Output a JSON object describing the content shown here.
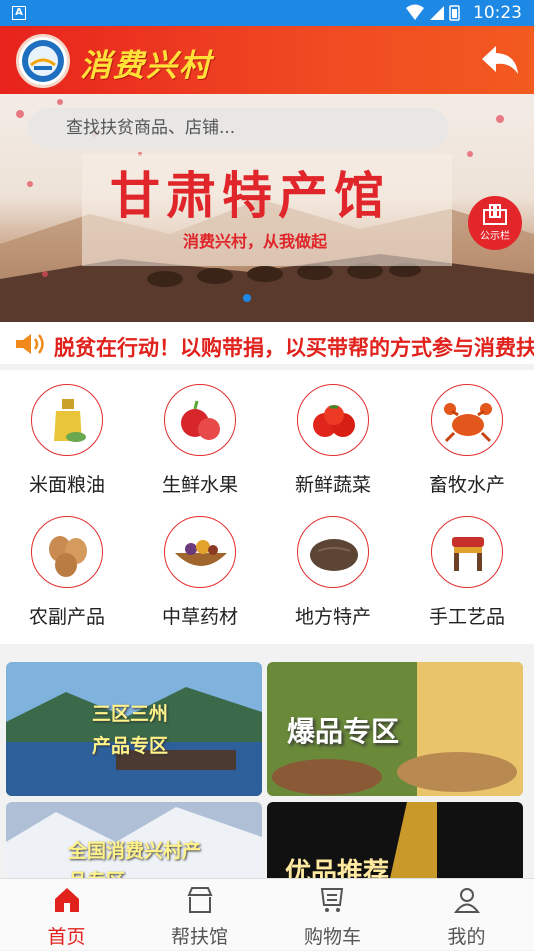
{
  "status_bar": {
    "time": "10:23",
    "sim_label": "A"
  },
  "header": {
    "app_title": "消费兴村"
  },
  "banner": {
    "search_placeholder": "查找扶贫商品、店铺...",
    "notice_label": "公示栏",
    "title": "甘肃特产馆",
    "subtitle": "消费兴村，从我做起"
  },
  "ticker": {
    "text": "脱贫在行动！以购带捐，以买带帮的方式参与消费扶贫"
  },
  "categories": [
    {
      "label": "米面粮油",
      "icon": "oil-bottle-icon"
    },
    {
      "label": "生鲜水果",
      "icon": "apple-icon"
    },
    {
      "label": "新鲜蔬菜",
      "icon": "tomato-icon"
    },
    {
      "label": "畜牧水产",
      "icon": "crab-icon"
    },
    {
      "label": "农副产品",
      "icon": "eggs-icon"
    },
    {
      "label": "中草药材",
      "icon": "herb-basket-icon"
    },
    {
      "label": "地方特产",
      "icon": "bread-icon"
    },
    {
      "label": "手工艺品",
      "icon": "stool-icon"
    }
  ],
  "promos": [
    {
      "label": "三区三州产品专区"
    },
    {
      "label": "爆品专区"
    },
    {
      "label": "全国消费兴村产品专区"
    },
    {
      "label": "优品推荐"
    }
  ],
  "tabs": [
    {
      "label": "首页",
      "active": true
    },
    {
      "label": "帮扶馆",
      "active": false
    },
    {
      "label": "购物车",
      "active": false
    },
    {
      "label": "我的",
      "active": false
    }
  ],
  "colors": {
    "brand_red": "#e0211c",
    "status_blue": "#1e88e5",
    "title_yellow": "#ffe13a"
  }
}
